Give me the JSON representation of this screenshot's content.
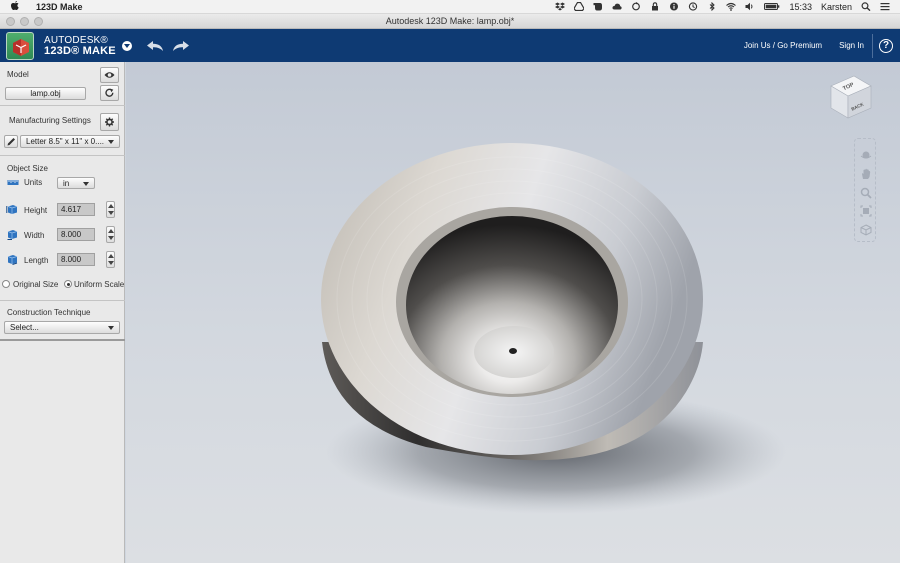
{
  "menubar": {
    "app_name": "123D Make",
    "clock": "15:33",
    "user": "Karsten",
    "icons": [
      "dropbox-icon",
      "drive-icon",
      "evernote-icon",
      "cloud-icon",
      "sync-icon",
      "lock-icon",
      "info-icon",
      "time-machine-icon",
      "bluetooth-icon",
      "wifi-icon",
      "volume-icon",
      "battery-icon",
      "search-icon",
      "menu-list-icon"
    ]
  },
  "window": {
    "title": "Autodesk 123D Make: lamp.obj*"
  },
  "appbar": {
    "brand_line1": "AUTODESK®",
    "brand_line2": "123D® MAKE",
    "join_link": "Join Us / Go Premium",
    "signin_link": "Sign In",
    "help_label": "?",
    "bg_color": "#0e3a73"
  },
  "panel": {
    "model": {
      "label": "Model",
      "file_button": "lamp.obj"
    },
    "manufacturing": {
      "label": "Manufacturing Settings",
      "sheet_select": "Letter 8.5\" x 11\" x 0...."
    },
    "object_size": {
      "label": "Object Size",
      "units_label": "Units",
      "units_value": "in",
      "height_label": "Height",
      "height_value": "4.617",
      "width_label": "Width",
      "width_value": "8.000",
      "length_label": "Length",
      "length_value": "8.000",
      "original_size_label": "Original Size",
      "uniform_scale_label": "Uniform Scale",
      "uniform_scale_selected": true
    },
    "construction": {
      "label": "Construction Technique",
      "select_value": "Select..."
    }
  },
  "viewport": {
    "viewcube_top": "TOP",
    "viewcube_back": "BACK",
    "nav_icons": [
      "orbit-icon",
      "pan-hand-icon",
      "zoom-icon",
      "fit-icon",
      "view-cube-icon"
    ]
  }
}
